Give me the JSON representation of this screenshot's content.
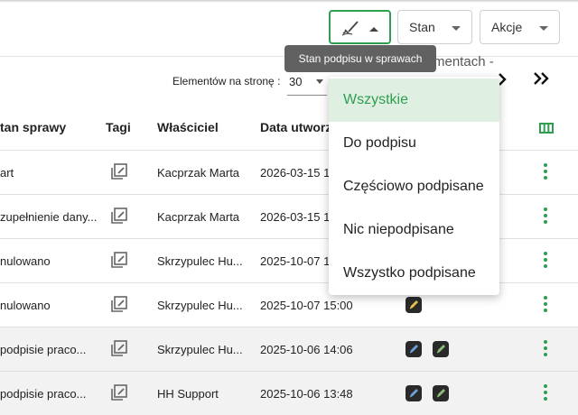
{
  "toolbar": {
    "sign_filter_icon": "signature-check-icon",
    "state_label": "Stan",
    "actions_label": "Akcje"
  },
  "tooltip": "Stan podpisu w sprawach",
  "pagination": {
    "hidden_text": "mentach -",
    "per_page_label": "Elementów na stronę :",
    "per_page_value": "30",
    "next_icon": "chevron-right-icon",
    "last_icon": "double-chevron-right-icon"
  },
  "table": {
    "headers": {
      "status": "tan sprawy",
      "tags": "Tagi",
      "owner": "Właściciel",
      "created": "Data utworz",
      "columns_icon": "columns-icon"
    },
    "rows": [
      {
        "status": "art",
        "owner": "Kacprzak Marta",
        "created": "2026-03-15 1",
        "badges": []
      },
      {
        "status": "zupełnienie dany...",
        "owner": "Kacprzak Marta",
        "created": "2026-03-15 1",
        "badges": []
      },
      {
        "status": "nulowano",
        "owner": "Skrzypulec Hu...",
        "created": "2025-10-07 1",
        "badges": []
      },
      {
        "status": "nulowano",
        "owner": "Skrzypulec Hu...",
        "created": "2025-10-07 15:00",
        "badges": [
          "yellow"
        ]
      },
      {
        "status": " podpisie praco...",
        "owner": "Skrzypulec Hu...",
        "created": "2025-10-06 14:06",
        "badges": [
          "blue",
          "green"
        ]
      },
      {
        "status": " podpisie praco...",
        "owner": "HH Support",
        "created": "2025-10-06 13:48",
        "badges": [
          "blue",
          "green"
        ]
      }
    ]
  },
  "dropdown": {
    "items": [
      "Wszystkie",
      "Do podpisu",
      "Częściowo podpisane",
      "Nic niepodpisane",
      "Wszystko podpisane"
    ],
    "selected": "Wszystkie"
  },
  "colors": {
    "accent": "#2e9e4f",
    "badge_yellow": "#e8c64a",
    "badge_blue": "#6fa1d8",
    "badge_green": "#8dc07a"
  }
}
